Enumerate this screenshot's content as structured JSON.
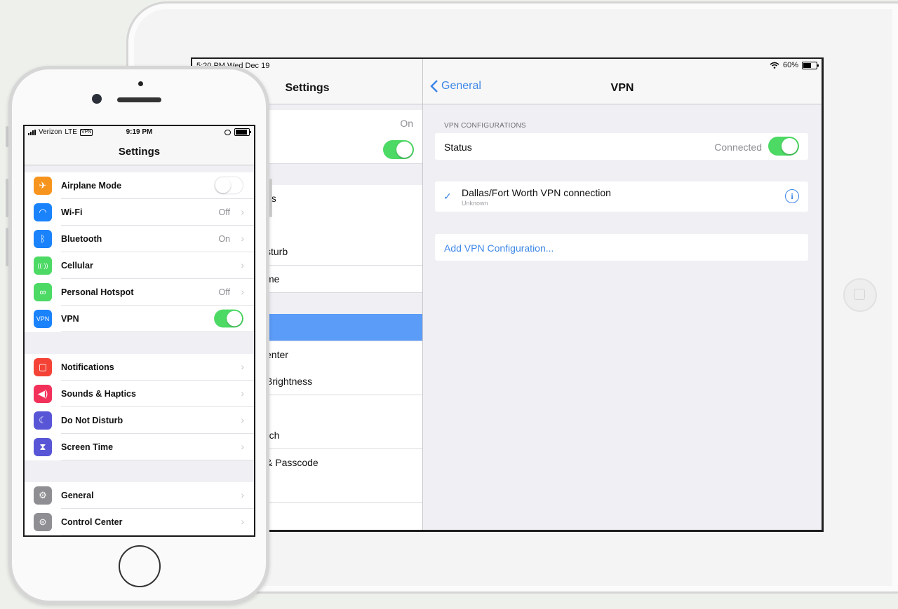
{
  "ipad": {
    "status": {
      "time": "5:20 PM   Wed Dec 19",
      "battery": "60%"
    },
    "left": {
      "title": "Settings",
      "rows": [
        {
          "label": "",
          "value": "On"
        },
        {
          "label": "",
          "value": ""
        },
        {
          "label": "ns",
          "value": ""
        },
        {
          "label": "",
          "value": ""
        },
        {
          "label": "sturb",
          "value": ""
        },
        {
          "label": "me",
          "value": ""
        },
        {
          "label": "",
          "value": ""
        },
        {
          "label": "enter",
          "value": ""
        },
        {
          "label": "Brightness",
          "value": ""
        },
        {
          "label": "",
          "value": ""
        },
        {
          "label": "rch",
          "value": ""
        },
        {
          "label": "& Passcode",
          "value": ""
        },
        {
          "label": "",
          "value": ""
        },
        {
          "label": "",
          "value": ""
        }
      ]
    },
    "right": {
      "back_label": "General",
      "title": "VPN",
      "section_label": "VPN CONFIGURATIONS",
      "status_label": "Status",
      "status_value": "Connected",
      "vpn_name": "Dallas/Fort Worth VPN connection",
      "vpn_sub": "Unknown",
      "add_label": "Add VPN Configuration..."
    }
  },
  "iphone": {
    "status": {
      "carrier": "Verizon",
      "network": "LTE",
      "vpn_badge": "VPN",
      "time": "9:19 PM"
    },
    "title": "Settings",
    "rows": [
      {
        "label": "Airplane Mode",
        "value": "",
        "icon": "airplane-icon",
        "glyph": "✈",
        "color": "#f7941d"
      },
      {
        "label": "Wi-Fi",
        "value": "Off",
        "icon": "wifi-icon",
        "glyph": "◠",
        "color": "#1a82fb"
      },
      {
        "label": "Bluetooth",
        "value": "On",
        "icon": "bluetooth-icon",
        "glyph": "ᛒ",
        "color": "#1a82fb"
      },
      {
        "label": "Cellular",
        "value": "",
        "icon": "cellular-icon",
        "glyph": "((·))",
        "color": "#4cd964"
      },
      {
        "label": "Personal Hotspot",
        "value": "Off",
        "icon": "hotspot-icon",
        "glyph": "∞",
        "color": "#4cd964"
      },
      {
        "label": "VPN",
        "value": "",
        "icon": "vpn-icon",
        "glyph": "VPN",
        "color": "#1a82fb"
      },
      {
        "label": "Notifications",
        "value": "",
        "icon": "notifications-icon",
        "glyph": "▢",
        "color": "#f44336"
      },
      {
        "label": "Sounds & Haptics",
        "value": "",
        "icon": "sounds-icon",
        "glyph": "◀)",
        "color": "#f2315a"
      },
      {
        "label": "Do Not Disturb",
        "value": "",
        "icon": "moon-icon",
        "glyph": "☾",
        "color": "#5856d6"
      },
      {
        "label": "Screen Time",
        "value": "",
        "icon": "hourglass-icon",
        "glyph": "⧗",
        "color": "#5856d6"
      },
      {
        "label": "General",
        "value": "",
        "icon": "gear-icon",
        "glyph": "⚙",
        "color": "#8e8e93"
      },
      {
        "label": "Control Center",
        "value": "",
        "icon": "control-center-icon",
        "glyph": "⊜",
        "color": "#8e8e93"
      }
    ]
  }
}
